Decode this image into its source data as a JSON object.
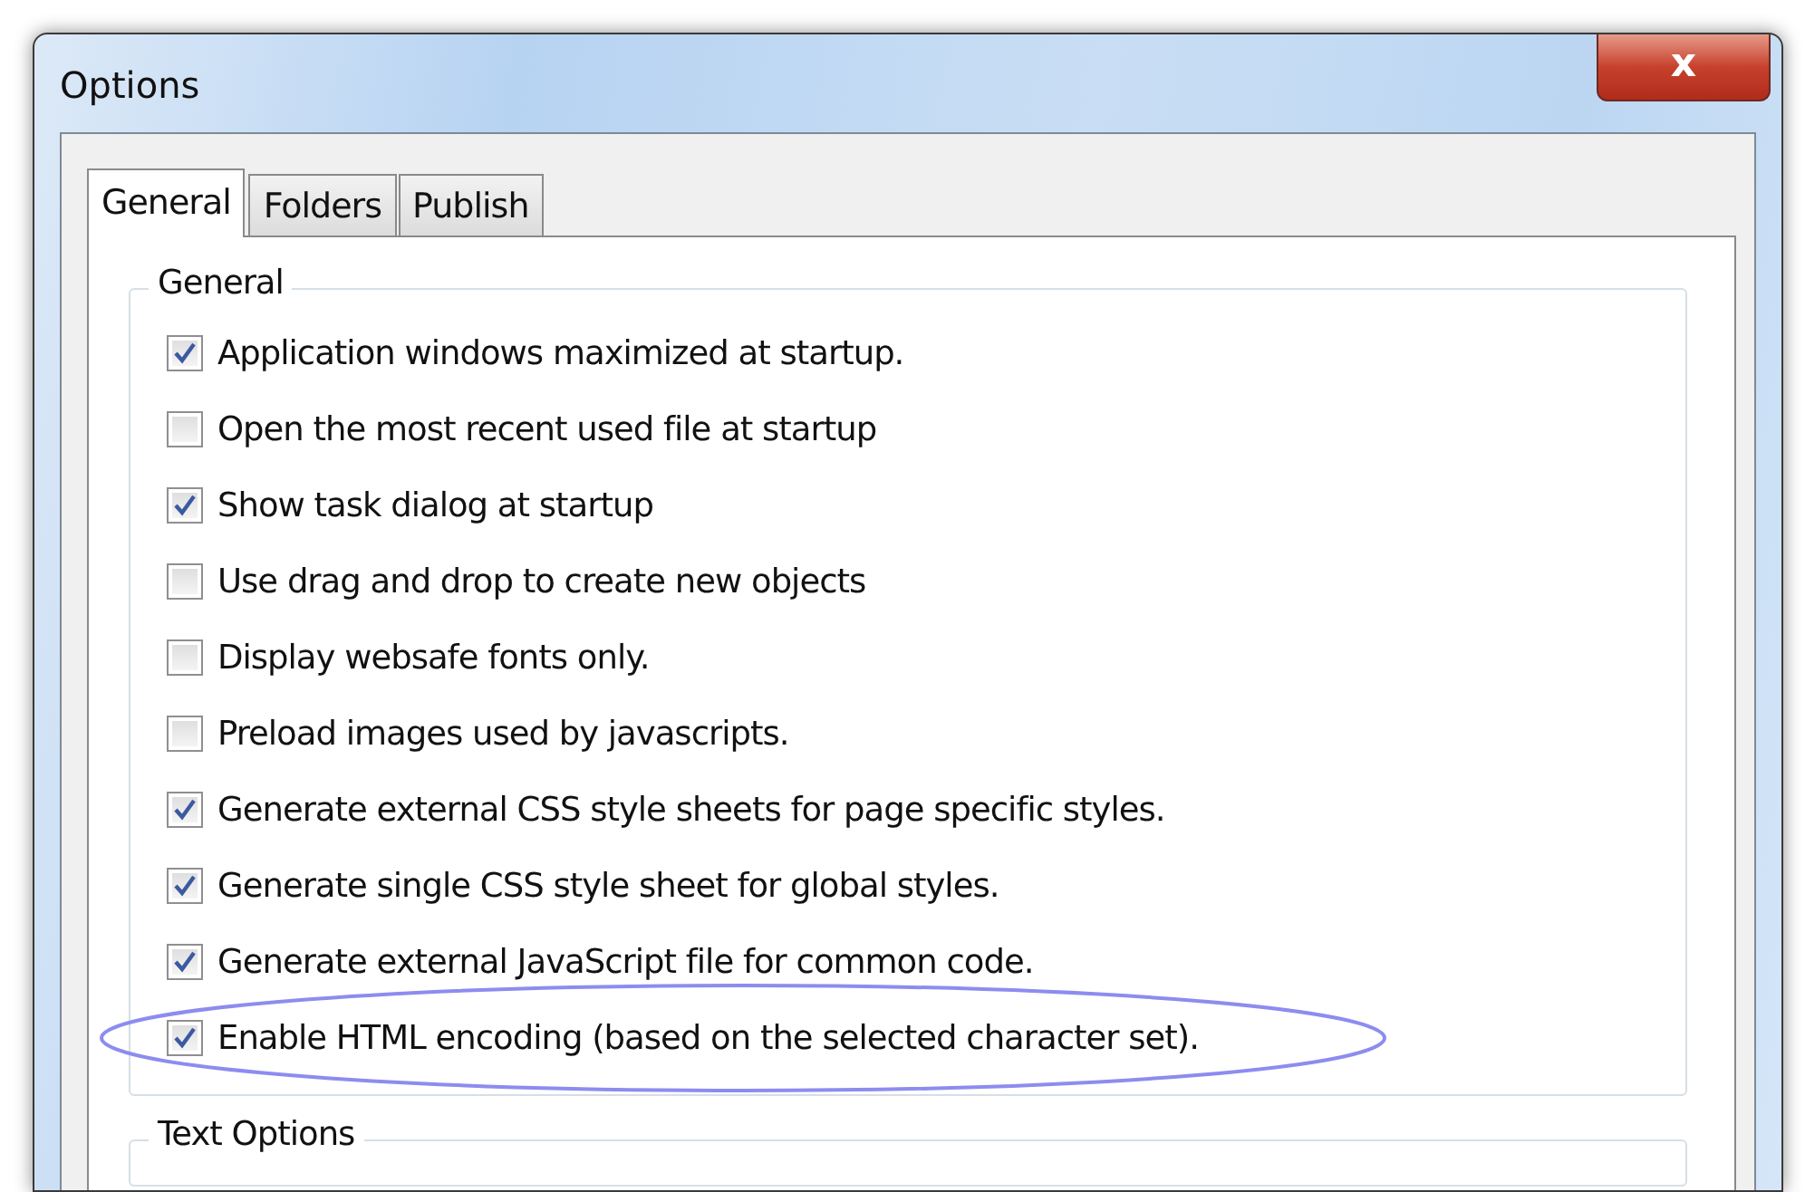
{
  "window": {
    "title": "Options",
    "close": "x"
  },
  "tabs": [
    {
      "label": "General",
      "selected": true
    },
    {
      "label": "Folders",
      "selected": false
    },
    {
      "label": "Publish",
      "selected": false
    }
  ],
  "groups": [
    {
      "title": "General",
      "options": [
        {
          "label": "Application windows maximized at startup.",
          "checked": true,
          "highlighted": false
        },
        {
          "label": "Open the most recent used file at startup",
          "checked": false,
          "highlighted": false
        },
        {
          "label": "Show task dialog at startup",
          "checked": true,
          "highlighted": false
        },
        {
          "label": "Use drag and drop to create new objects",
          "checked": false,
          "highlighted": false
        },
        {
          "label": "Display websafe fonts only.",
          "checked": false,
          "highlighted": false
        },
        {
          "label": "Preload images used by javascripts.",
          "checked": false,
          "highlighted": false
        },
        {
          "label": "Generate external CSS style sheets for page specific styles.",
          "checked": true,
          "highlighted": false
        },
        {
          "label": "Generate single CSS style sheet for global styles.",
          "checked": true,
          "highlighted": false
        },
        {
          "label": "Generate external JavaScript file for common code.",
          "checked": true,
          "highlighted": false
        },
        {
          "label": "Enable HTML encoding (based on the selected character set).",
          "checked": true,
          "highlighted": true
        }
      ]
    },
    {
      "title": "Text Options"
    }
  ]
}
